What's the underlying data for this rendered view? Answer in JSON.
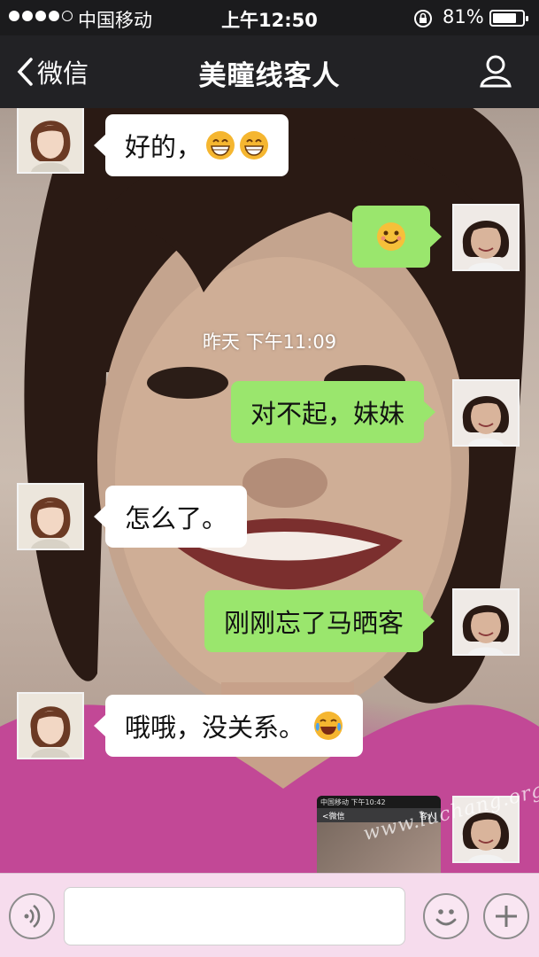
{
  "status_bar": {
    "carrier": "中国移动",
    "time": "上午12:50",
    "battery_percent": "81%",
    "battery_level": 0.81
  },
  "nav": {
    "back_label": "微信",
    "title": "美瞳线客人"
  },
  "messages": [
    {
      "side": "in",
      "text": "好的，",
      "emoji": [
        "grin-icon",
        "grin-icon"
      ]
    },
    {
      "side": "out",
      "text": "",
      "emoji": [
        "smile-icon"
      ]
    },
    {
      "side": "out",
      "text": "对不起，妹妹",
      "emoji": []
    },
    {
      "side": "in",
      "text": "怎么了。",
      "emoji": []
    },
    {
      "side": "out",
      "text": "刚刚忘了马晒客",
      "emoji": []
    },
    {
      "side": "in",
      "text": "哦哦，没关系。",
      "emoji": [
        "tears-of-joy-icon"
      ]
    },
    {
      "side": "out",
      "text": "",
      "emoji": [],
      "image": true
    }
  ],
  "timestamp": "昨天 下午11:09",
  "thumbnail": {
    "back": "<微信",
    "title": "客人",
    "carrier": "中国移动",
    "time": "下午10:42"
  },
  "input": {
    "placeholder": ""
  },
  "watermark": "www.luchang.org",
  "colors": {
    "out_bubble": "#9ae66d",
    "in_bubble": "#ffffff",
    "nav_bg": "#222225"
  }
}
